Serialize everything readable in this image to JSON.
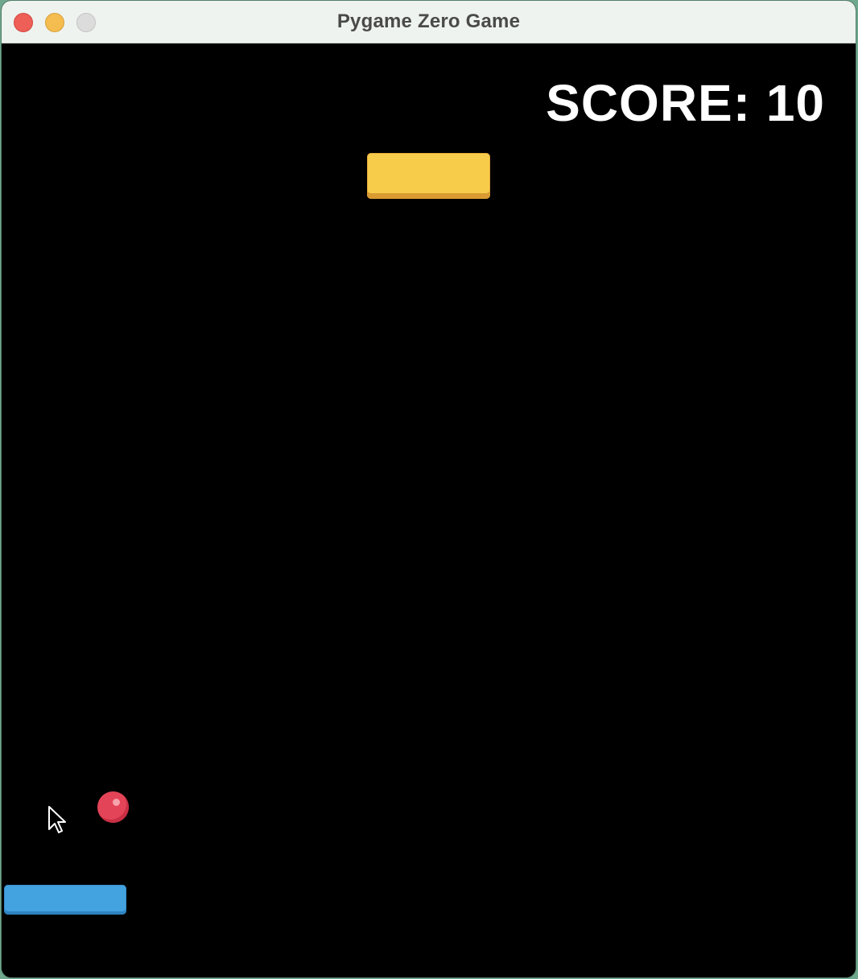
{
  "window": {
    "title": "Pygame Zero Game"
  },
  "hud": {
    "score_text": "SCORE: 10"
  },
  "colors": {
    "background": "#000000",
    "block": "#f8cc4b",
    "ball": "#e44458",
    "paddle": "#43a2e0",
    "score_text": "#ffffff"
  },
  "icons": {
    "close": "close-icon",
    "minimize": "minimize-icon",
    "zoom": "zoom-icon",
    "cursor": "mouse-cursor-icon"
  }
}
